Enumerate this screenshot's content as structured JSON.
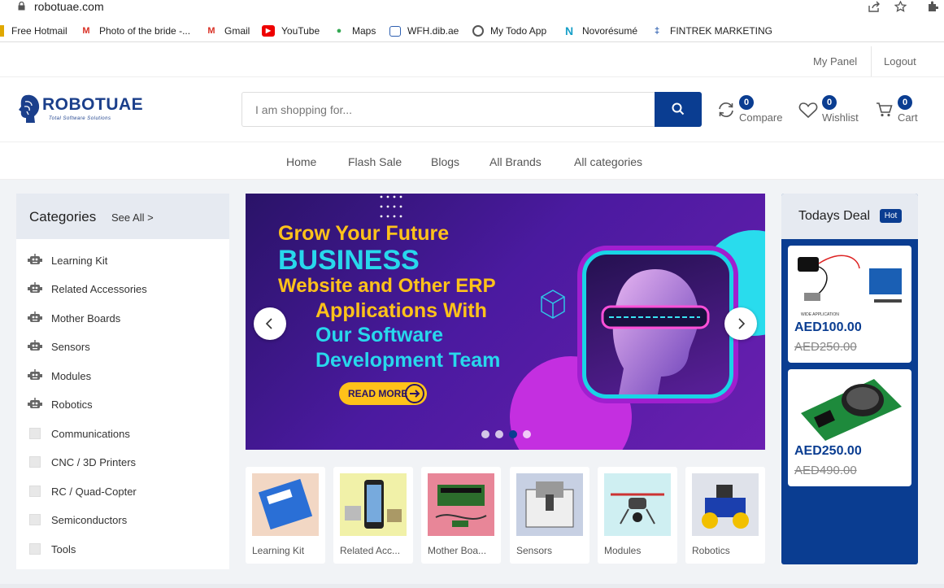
{
  "browser": {
    "url": "robotuae.com",
    "bookmarks": [
      {
        "label": "Free Hotmail",
        "icon": "hotmail-icon"
      },
      {
        "label": "Photo of the bride -...",
        "icon": "gmail-icon"
      },
      {
        "label": "Gmail",
        "icon": "gmail-icon"
      },
      {
        "label": "YouTube",
        "icon": "youtube-icon"
      },
      {
        "label": "Maps",
        "icon": "maps-icon"
      },
      {
        "label": "WFH.dib.ae",
        "icon": "briefcase-icon"
      },
      {
        "label": "My Todo App",
        "icon": "globe-icon"
      },
      {
        "label": "Novorésumé",
        "icon": "novoresume-icon"
      },
      {
        "label": "FINTREK MARKETING",
        "icon": "fintrek-icon"
      }
    ]
  },
  "topnav": {
    "my_panel": "My Panel",
    "logout": "Logout"
  },
  "header": {
    "logo_text": "ROBOTUAE",
    "logo_sub": "Total Software Solutions",
    "search_placeholder": "I am shopping for...",
    "compare": {
      "label": "Compare",
      "count": "0"
    },
    "wishlist": {
      "label": "Wishlist",
      "count": "0"
    },
    "cart": {
      "label": "Cart",
      "count": "0"
    }
  },
  "menu": [
    "Home",
    "Flash Sale",
    "Blogs",
    "All Brands",
    "All categories"
  ],
  "categories": {
    "title": "Categories",
    "see_all": "See All >",
    "items": [
      {
        "label": "Learning Kit",
        "icon": "robot-icon"
      },
      {
        "label": "Related Accessories",
        "icon": "robot-icon"
      },
      {
        "label": "Mother Boards",
        "icon": "robot-icon"
      },
      {
        "label": "Sensors",
        "icon": "robot-icon"
      },
      {
        "label": "Modules",
        "icon": "robot-icon"
      },
      {
        "label": "Robotics",
        "icon": "robot-icon"
      },
      {
        "label": "Communications",
        "icon": "placeholder-icon"
      },
      {
        "label": "CNC / 3D Printers",
        "icon": "placeholder-icon"
      },
      {
        "label": "RC / Quad-Copter",
        "icon": "placeholder-icon"
      },
      {
        "label": "Semiconductors",
        "icon": "placeholder-icon"
      },
      {
        "label": "Tools",
        "icon": "placeholder-icon"
      }
    ]
  },
  "banner": {
    "line1": "Grow Your Future",
    "line2": "BUSINESS",
    "line3": "Website and Other ERP",
    "line4": "Applications With",
    "line5": "Our Software",
    "line6": "Development Team",
    "read_more": "READ MORE",
    "slides": 4,
    "active_slide": 3
  },
  "cards": [
    {
      "label": "Learning Kit"
    },
    {
      "label": "Related Acc..."
    },
    {
      "label": "Mother Boa..."
    },
    {
      "label": "Sensors"
    },
    {
      "label": "Modules"
    },
    {
      "label": "Robotics"
    }
  ],
  "deal": {
    "title": "Todays Deal",
    "badge": "Hot",
    "items": [
      {
        "price": "AED100.00",
        "old_price": "AED250.00",
        "img_caption": "WIDE APPLICATION"
      },
      {
        "price": "AED250.00",
        "old_price": "AED490.00"
      }
    ]
  },
  "colors": {
    "brand": "#0a3d91",
    "banner_yellow": "#ffc21a",
    "banner_cyan": "#28d8ec"
  }
}
